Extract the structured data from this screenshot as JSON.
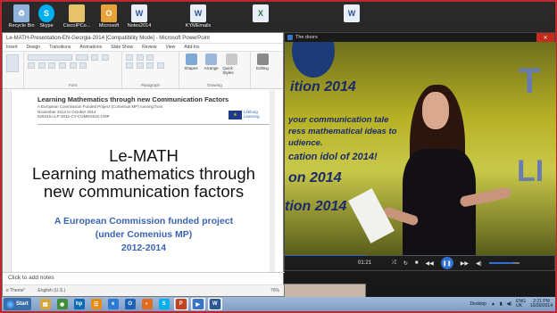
{
  "desktop": {
    "icons": [
      {
        "label": "Recycle Bin",
        "icon": "recycle-bin-icon",
        "color": "#8fb3d9",
        "glyph": "♻"
      },
      {
        "label": "Skype",
        "icon": "skype-icon",
        "color": "#00aff0",
        "glyph": "S"
      },
      {
        "label": "CiscoIPCo...",
        "icon": "folder-icon",
        "color": "#e6c36a",
        "glyph": ""
      },
      {
        "label": "Microsoft",
        "icon": "outlook-icon",
        "color": "#e8a23a",
        "glyph": "O"
      },
      {
        "label": "Notes2014",
        "icon": "word-doc-icon",
        "color": "#e9eef6",
        "glyph": "W"
      },
      {
        "label": "KYMEmails",
        "icon": "word-doc-icon",
        "color": "#e9eef6",
        "glyph": "W"
      },
      {
        "label": "",
        "icon": "excel-doc-icon",
        "color": "#e9eef6",
        "glyph": "X"
      },
      {
        "label": "",
        "icon": "word-doc-icon",
        "color": "#e9eef6",
        "glyph": "W"
      }
    ]
  },
  "ppt": {
    "title": "Le-MATH-Presentation-EN-Georgia-2014 [Compatibility Mode] - Microsoft PowerPoint",
    "tabs": [
      "Insert",
      "Design",
      "Transitions",
      "Animations",
      "Slide Show",
      "Review",
      "View",
      "Add-Ins"
    ],
    "ribbon_groups": {
      "font": "Font",
      "paragraph": "Paragraph",
      "drawing": "Drawing"
    },
    "ribbon_buttons": {
      "shapes": "Shapes",
      "arrange": "Arrange",
      "quick_styles": "Quick Styles",
      "editing": "Editing"
    },
    "slide": {
      "header_title": "Learning Mathematics through new Communication Factors",
      "header_sub_1": "A European Commission Funded Project (Comenius MP) running from",
      "header_sub_2": "November 2012 to October 2014",
      "header_sub_3": "526315-LLP-2012-CY-COMENIUS-CMP",
      "lifelong_1": "Lifelong",
      "lifelong_2": "Learning",
      "main_title_1": "Le-MATH",
      "main_title_2": "Learning mathematics through",
      "main_title_3": "new communication factors",
      "project_1": "A European Commission funded project",
      "project_2": "(under Comenius MP)",
      "project_3": "2012-2014"
    },
    "notes_placeholder": "Click to add notes",
    "status": {
      "theme": "e Theme\"",
      "language": "English (U.S.)",
      "zoom": "76%"
    }
  },
  "video": {
    "title": "The doors",
    "close": "✕",
    "time": "01:21",
    "progress": 0.3,
    "volume": 0.8,
    "banner": {
      "t_letter": "T",
      "line1": "ition 2014",
      "line2": "your communication tale",
      "line3": "ress mathematical ideas to",
      "line4": "udience.",
      "line5": "cation idol of 2014!",
      "line6": "on 2014",
      "line7": "tion 2014",
      "li_letters": "LI"
    }
  },
  "taskbar": {
    "start": "Start",
    "apps": [
      {
        "icon": "file-explorer-icon",
        "color": "#d7a63a",
        "glyph": "▤",
        "active": false
      },
      {
        "icon": "chrome-icon",
        "color": "#3f8f3a",
        "glyph": "◉",
        "active": false
      },
      {
        "icon": "hp-icon",
        "color": "#0a6ab8",
        "glyph": "hp",
        "active": false
      },
      {
        "icon": "rss-icon",
        "color": "#e68a1a",
        "glyph": "☰",
        "active": false
      },
      {
        "icon": "internet-explorer-icon",
        "color": "#2a7ad6",
        "glyph": "e",
        "active": false
      },
      {
        "icon": "outlook-icon",
        "color": "#1e63b8",
        "glyph": "O",
        "active": false
      },
      {
        "icon": "firefox-icon",
        "color": "#e06b1e",
        "glyph": "◐",
        "active": false
      },
      {
        "icon": "skype-icon",
        "color": "#00aff0",
        "glyph": "S",
        "active": false
      },
      {
        "icon": "powerpoint-icon",
        "color": "#c4431f",
        "glyph": "P",
        "active": true
      },
      {
        "icon": "media-player-icon",
        "color": "#3a74c4",
        "glyph": "▶",
        "active": true
      },
      {
        "icon": "word-icon",
        "color": "#2b5797",
        "glyph": "W",
        "active": true
      }
    ],
    "tray": {
      "desktop": "Desktop",
      "lang_1": "ENG",
      "lang_2": "UK",
      "time": "2:21 PM",
      "date": "10/30/2014"
    }
  }
}
